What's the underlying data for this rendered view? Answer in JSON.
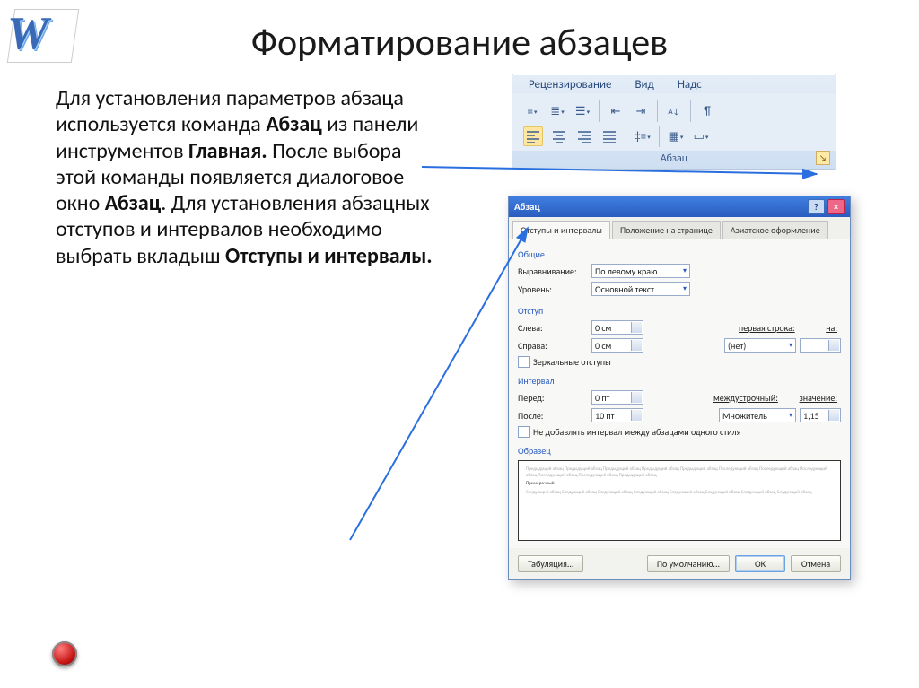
{
  "title": "Форматирование абзацев",
  "body": {
    "t1": "Для установления параметров абзаца используется команда ",
    "b1": "Абзац",
    "t2": " из панели инструментов ",
    "b2": "Главная.",
    "t3": " После выбора этой команды появляется диалоговое окно ",
    "b3": "Абзац",
    "t4": ". Для установления абзацных отступов и интервалов необходимо выбрать вкладыш ",
    "b4": "Отступы и интервалы."
  },
  "ribbon": {
    "tabs": [
      "Рецензирование",
      "Вид",
      "Надс"
    ],
    "group_label": "Абзац"
  },
  "dialog": {
    "title": "Абзац",
    "tabs": [
      "Отступы и интервалы",
      "Положение на странице",
      "Азиатское оформление"
    ],
    "groups": {
      "general": "Общие",
      "align_label": "Выравнивание:",
      "align_value": "По левому краю",
      "level_label": "Уровень:",
      "level_value": "Основной текст",
      "indent": "Отступ",
      "left_label": "Слева:",
      "left_value": "0 см",
      "right_label": "Справа:",
      "right_value": "0 см",
      "firstline_label": "первая строка:",
      "firstline_value": "(нет)",
      "on_label": "на:",
      "mirror_check": "Зеркальные отступы",
      "spacing": "Интервал",
      "before_label": "Перед:",
      "before_value": "0 пт",
      "after_label": "После:",
      "after_value": "10 пт",
      "line_label": "междустрочный:",
      "line_value": "Множитель",
      "val_label": "значение:",
      "val_value": "1,15",
      "sames_style_check": "Не добавлять интервал между абзацами одного стиля",
      "sample": "Образец",
      "preview_prev": "Предыдущий абзац Предыдущий абзац Предыдущий абзац Предыдущий абзац Предыдущий абзац Последующий абзац Последующий абзац Последующий абзац Последующий абзац Последующий абзац Предыдущий абзац",
      "preview_mid": "Примерочный",
      "preview_next": "Следующий абзац Следующий абзац Следующий абзац Следующий абзац Следующий абзац Следующий абзац Следующий абзац Следующий абзац"
    },
    "buttons": {
      "tabs": "Табуляция...",
      "default": "По умолчанию...",
      "ok": "ОК",
      "cancel": "Отмена"
    }
  }
}
